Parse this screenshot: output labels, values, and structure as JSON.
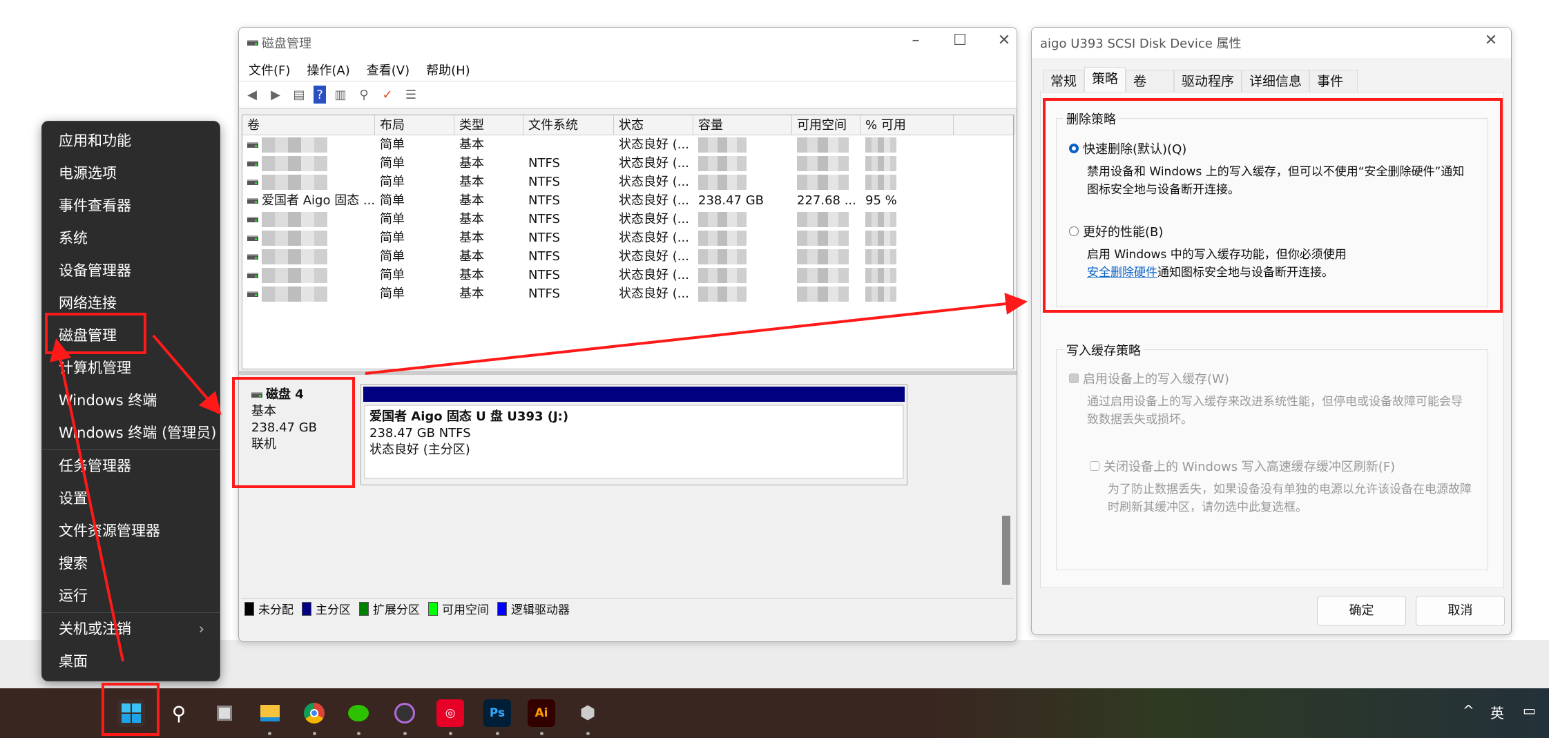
{
  "context_menu": {
    "items": [
      "应用和功能",
      "电源选项",
      "事件查看器",
      "系统",
      "设备管理器",
      "网络连接",
      "磁盘管理",
      "计算机管理",
      "Windows 终端",
      "Windows 终端 (管理员)",
      "任务管理器",
      "设置",
      "文件资源管理器",
      "搜索",
      "运行",
      "关机或注销",
      "桌面"
    ],
    "submenu_chevron": "›"
  },
  "disk_mgmt": {
    "title": "磁盘管理",
    "controls": {
      "minimize": "–",
      "maximize": "☐",
      "close": "✕"
    },
    "menu": [
      "文件(F)",
      "操作(A)",
      "查看(V)",
      "帮助(H)"
    ],
    "columns": [
      "卷",
      "布局",
      "类型",
      "文件系统",
      "状态",
      "容量",
      "可用空间",
      "% 可用"
    ],
    "rows": [
      {
        "volume": "",
        "layout": "简单",
        "type": "基本",
        "fs": "",
        "status": "状态良好 (...",
        "capacity": "",
        "free": "",
        "pct": ""
      },
      {
        "volume": "",
        "layout": "简单",
        "type": "基本",
        "fs": "NTFS",
        "status": "状态良好 (...",
        "capacity": "",
        "free": "",
        "pct": ""
      },
      {
        "volume": "",
        "layout": "简单",
        "type": "基本",
        "fs": "NTFS",
        "status": "状态良好 (...",
        "capacity": "",
        "free": "",
        "pct": ""
      },
      {
        "volume": "爱国者 Aigo 固态 ...",
        "layout": "简单",
        "type": "基本",
        "fs": "NTFS",
        "status": "状态良好 (...",
        "capacity": "238.47 GB",
        "free": "227.68 ...",
        "pct": "95 %"
      },
      {
        "volume": "",
        "layout": "简单",
        "type": "基本",
        "fs": "NTFS",
        "status": "状态良好 (...",
        "capacity": "",
        "free": "",
        "pct": ""
      },
      {
        "volume": "",
        "layout": "简单",
        "type": "基本",
        "fs": "NTFS",
        "status": "状态良好 (...",
        "capacity": "",
        "free": "",
        "pct": ""
      },
      {
        "volume": "",
        "layout": "简单",
        "type": "基本",
        "fs": "NTFS",
        "status": "状态良好 (...",
        "capacity": "",
        "free": "",
        "pct": ""
      },
      {
        "volume": "",
        "layout": "简单",
        "type": "基本",
        "fs": "NTFS",
        "status": "状态良好 (...",
        "capacity": "",
        "free": "",
        "pct": ""
      },
      {
        "volume": "",
        "layout": "简单",
        "type": "基本",
        "fs": "NTFS",
        "status": "状态良好 (...",
        "capacity": "",
        "free": "",
        "pct": ""
      }
    ],
    "disk": {
      "name": "磁盘 4",
      "type": "基本",
      "size": "238.47 GB",
      "state": "联机"
    },
    "partition": {
      "name": "爱国者 Aigo 固态 U 盘 U393  (J:)",
      "size_fs": "238.47 GB NTFS",
      "status": "状态良好 (主分区)",
      "color": "#000080"
    },
    "legend": [
      {
        "label": "未分配",
        "color": "#000000"
      },
      {
        "label": "主分区",
        "color": "#000080"
      },
      {
        "label": "扩展分区",
        "color": "#008000"
      },
      {
        "label": "可用空间",
        "color": "#00ff00"
      },
      {
        "label": "逻辑驱动器",
        "color": "#0000ff"
      }
    ]
  },
  "dialog": {
    "title": "aigo U393 SCSI Disk Device 属性",
    "close": "✕",
    "tabs": [
      "常规",
      "策略",
      "卷",
      "驱动程序",
      "详细信息",
      "事件"
    ],
    "removal": {
      "title": "删除策略",
      "quick": {
        "label": "快速删除(默认)(Q)",
        "desc": "禁用设备和 Windows 上的写入缓存，但可以不使用“安全删除硬件”通知图标安全地与设备断开连接。"
      },
      "better": {
        "label": "更好的性能(B)",
        "desc1": "启用 Windows 中的写入缓存功能，但你必须使用",
        "link": "安全删除硬件",
        "desc2": "通知图标安全地与设备断开连接。"
      }
    },
    "write_cache": {
      "title": "写入缓存策略",
      "enable": {
        "label": "启用设备上的写入缓存(W)",
        "desc": "通过启用设备上的写入缓存来改进系统性能，但停电或设备故障可能会导致数据丢失或损坏。"
      },
      "flush": {
        "label": "关闭设备上的 Windows 写入高速缓存缓冲区刷新(F)",
        "desc": "为了防止数据丢失，如果设备没有单独的电源以允许该设备在电源故障时刷新其缓冲区，请勿选中此复选框。"
      }
    },
    "ok": "确定",
    "cancel": "取消"
  },
  "taskbar": {
    "apps": [
      "start",
      "search",
      "task-view",
      "file-explorer",
      "chrome",
      "wechat",
      "music",
      "netease-music",
      "photoshop",
      "illustrator",
      "app"
    ],
    "ps": "Ps",
    "ai": "Ai",
    "tray_chevron": "^",
    "ime": "英"
  },
  "colors": {
    "annotation": "#ff1a1a",
    "accent": "#0a5fc4"
  }
}
